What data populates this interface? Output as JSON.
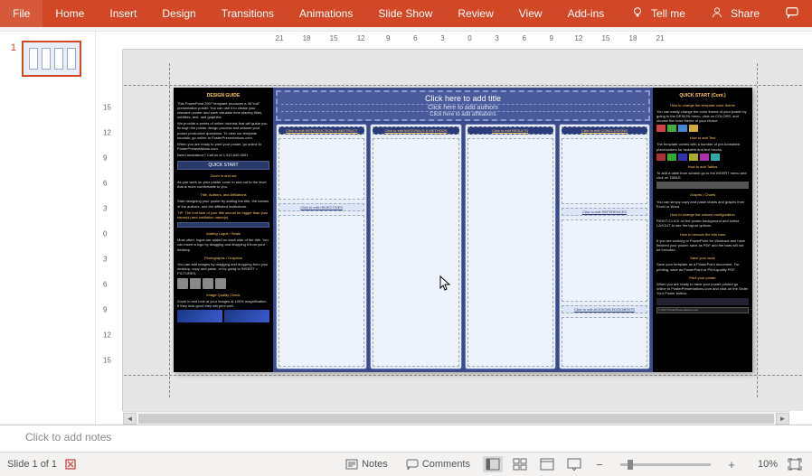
{
  "ribbon": {
    "tabs": [
      "File",
      "Home",
      "Insert",
      "Design",
      "Transitions",
      "Animations",
      "Slide Show",
      "Review",
      "View",
      "Add-ins"
    ],
    "tellme": "Tell me",
    "share": "Share"
  },
  "hruler": [
    "21",
    "18",
    "15",
    "12",
    "9",
    "6",
    "3",
    "0",
    "3",
    "6",
    "9",
    "12",
    "15",
    "18",
    "21"
  ],
  "vruler": [
    "15",
    "12",
    "9",
    "6",
    "3",
    "0",
    "3",
    "6",
    "9",
    "12",
    "15"
  ],
  "thumb_index": "1",
  "poster": {
    "left": {
      "title": "DESIGN GUIDE",
      "p1": "This PowerPoint 2007 template produces a 36\"x48\" presentation poster. You can use it to create your research poster and save valuable time placing titles, subtitles, text, and graphics.",
      "p2": "We provide a series of online tutorials that will guide you through the poster design process and answer your poster production questions. To view our template tutorials, go online to PosterPresentations.com.",
      "p3": "When you are ready to print your poster, go online to PosterPresentations.com",
      "p4": "Need assistance? Call us at 1.510.649.3001",
      "quickstart": "QUICK START",
      "zoom_h": "Zoom in and out",
      "zoom_t": "As you work on your poster zoom in and out to the level that is more comfortable to you.",
      "taa_h": "Title, Authors, and Affiliations",
      "taa_t": "Start designing your poster by adding the title, the names of the authors, and the affiliated institutions.",
      "tip": "TIP: The font size of your title should be bigger than your name(s) and institution name(s).",
      "logos_h": "Adding Logos / Seals",
      "logos_t": "Most often, logos are added on each side of the title. You can insert a logo by dragging and dropping it from your desktop.",
      "photo_h": "Photographs / Graphics",
      "photo_t": "You can add images by dragging and dropping from your desktop, copy and paste, or by going to INSERT > PICTURES.",
      "iq_h": "Image Quality Check",
      "iq_t": "Zoom in and look at your images at 100% magnification. If they look good they will print well."
    },
    "center": {
      "title": "Click here to add title",
      "authors": "Click here to add authors",
      "affil": "Click here to add affiliations",
      "col1_h": "Click to edit INTRODUCTION or ABSTRACT",
      "col1_mid": "Click to edit OBJECTIVES",
      "col2_h": "Click to edit MATERIALS & METHODS",
      "col3_h": "Click to edit RESULTS",
      "col4_h": "Click to edit CONCLUSIONS",
      "col4_mid1": "Click to edit REFERENCES",
      "col4_mid2": "Click to edit ACKNOWLEDGEMENTS"
    },
    "right": {
      "title": "QUICK START (Cont.)",
      "h1": "How to change the template color theme",
      "t1": "You can easily change the color theme of your poster by going to the DESIGN menu, click on COLORS, and choose the color theme of your choice.",
      "h2": "How to add Text",
      "t2": "The template comes with a number of pre-formatted placeholders for headers and text blocks.",
      "h3": "How to add Tables",
      "t3": "To add a table from scratch go to the INSERT menu and click on TABLE.",
      "h4": "Graphs / Charts",
      "t4": "You can simply copy and paste charts and graphs from Excel or Word.",
      "h5": "How to change the column configuration",
      "t5": "RIGHT-CLICK on the poster background and select LAYOUT to see the layout options.",
      "h6": "How to remove the info bars",
      "t6": "If you are working in PowerPoint for Windows and have finished your poster, save as PDF and the bars will not be included.",
      "h7": "Save your work",
      "t7": "Save your template as a PowerPoint document. For printing, save as PowerPoint or Print-quality PDF.",
      "h8": "Print your poster",
      "t8": "When you are ready to have your poster printed go online to PosterPresentations.com and click on the Order Your Poster button.",
      "footer": "© 2017 PosterPresentations.com"
    }
  },
  "notes_placeholder": "Click to add notes",
  "status": {
    "slide": "Slide 1 of 1",
    "notes": "Notes",
    "comments": "Comments",
    "zoom": "10%"
  }
}
